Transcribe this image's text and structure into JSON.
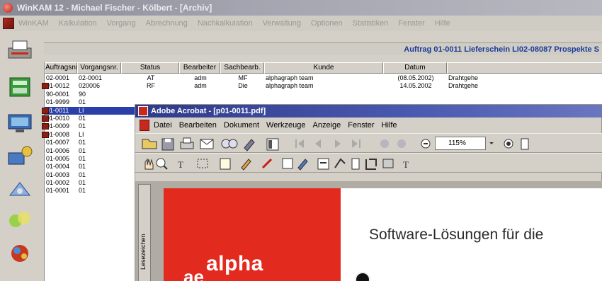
{
  "back_window": {
    "title": "WinKAM 12 - Michael Fischer - Kölbert - [Archiv]",
    "menu": [
      "WinKAM",
      "Kalkulation",
      "Vorgang",
      "Abrechnung",
      "Nachkalkulation",
      "Verwaltung",
      "Optionen",
      "Statistiken",
      "Fenster",
      "Hilfe"
    ]
  },
  "order_header": "Auftrag 01-0011  Lieferschein  LI02-08087  Prospekte S",
  "table": {
    "columns": [
      "Auftragsnr.",
      "Vorgangsnr.",
      "Status",
      "Bearbeiter",
      "Sachbearb.",
      "Kunde",
      "Datum",
      ""
    ],
    "rows": [
      [
        "02-0001",
        "02-0001",
        "AT",
        "adm",
        "MF",
        "alphagraph team",
        "(08.05.2002)",
        "Drahtgehe"
      ],
      [
        "01-0012",
        "020006",
        "RF",
        "adm",
        "Die",
        "alphagraph team",
        "14.05.2002",
        "Drahtgehe"
      ],
      [
        "90-0001",
        "90",
        "",
        "",
        "",
        "",
        "",
        ""
      ],
      [
        "01-9999",
        "01",
        "",
        "",
        "",
        "",
        "",
        ""
      ],
      [
        "01-0011",
        "LI",
        "",
        "",
        "",
        "",
        "",
        ""
      ],
      [
        "01-0010",
        "01",
        "",
        "",
        "",
        "",
        "",
        ""
      ],
      [
        "01-0009",
        "01",
        "",
        "",
        "",
        "",
        "",
        ""
      ],
      [
        "01-0008",
        "LI",
        "",
        "",
        "",
        "",
        "",
        ""
      ],
      [
        "01-0007",
        "01",
        "",
        "",
        "",
        "",
        "",
        ""
      ],
      [
        "01-0006",
        "01",
        "",
        "",
        "",
        "",
        "",
        ""
      ],
      [
        "01-0005",
        "01",
        "",
        "",
        "",
        "",
        "",
        ""
      ],
      [
        "01-0004",
        "01",
        "",
        "",
        "",
        "",
        "",
        ""
      ],
      [
        "01-0003",
        "01",
        "",
        "",
        "",
        "",
        "",
        ""
      ],
      [
        "01-0002",
        "01",
        "",
        "",
        "",
        "",
        "",
        ""
      ],
      [
        "01-0001",
        "01",
        "",
        "",
        "",
        "",
        "",
        ""
      ]
    ],
    "selected_row": "01-0011"
  },
  "acrobat": {
    "title": "Adobe Acrobat - [p01-0011.pdf]",
    "menu": [
      "Datei",
      "Bearbeiten",
      "Dokument",
      "Werkzeuge",
      "Anzeige",
      "Fenster",
      "Hilfe"
    ],
    "zoom": "115%",
    "bookmarks_tab": "Lesezeichen",
    "page_headline": "Software-Lösungen für die",
    "logo_text": "alpha",
    "logo_prefix": "ae"
  },
  "colors": {
    "accent_red": "#e22a1e",
    "selection_blue": "#2a3fa8",
    "header_blue": "#1a3a9a"
  }
}
